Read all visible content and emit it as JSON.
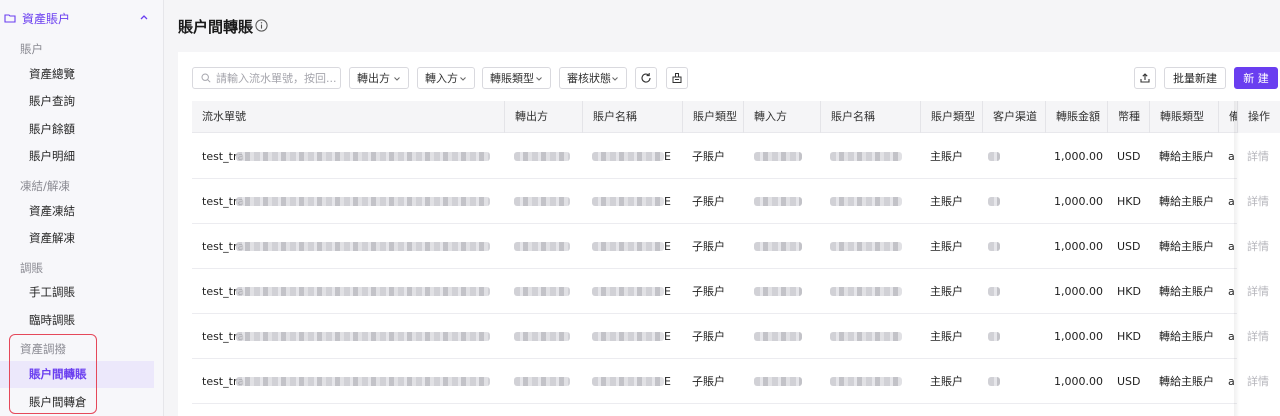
{
  "sidebar": {
    "top_label": "資產賬户",
    "groups": [
      {
        "label": "賬户",
        "items": [
          "資產總覽",
          "賬户查詢",
          "賬户餘額",
          "賬户明細"
        ]
      },
      {
        "label": "凍結/解凍",
        "items": [
          "資產凍結",
          "資產解凍"
        ]
      },
      {
        "label": "調賬",
        "items": [
          "手工調賬",
          "臨時調賬"
        ]
      },
      {
        "label": "資產調撥",
        "items": [
          "賬户間轉賬",
          "賬户間轉倉"
        ]
      }
    ],
    "active_item": "賬户間轉賬"
  },
  "page": {
    "title": "賬户間轉賬"
  },
  "filters": {
    "search_placeholder": "請輸入流水單號，按回...",
    "dropdowns": [
      "轉出方",
      "轉入方",
      "轉賬類型",
      "審核狀態"
    ]
  },
  "actions": {
    "batch_label": "批量新建",
    "new_label": "新 建"
  },
  "table": {
    "columns": [
      "流水單號",
      "轉出方",
      "賬户名稱",
      "賬户類型",
      "轉入方",
      "賬户名稱",
      "賬户類型",
      "客户渠道",
      "轉賬金額",
      "幣種",
      "轉賬類型",
      "備",
      "操作"
    ],
    "rows": [
      {
        "serial_prefix": "test_tra",
        "name_suffix": "E",
        "out_type": "子賬户",
        "in_type": "主賬户",
        "amount": "1,000.00",
        "currency": "USD",
        "transfer_type": "轉給主賬户",
        "remark": "a",
        "action": "詳情"
      },
      {
        "serial_prefix": "test_tra",
        "name_suffix": "E",
        "out_type": "子賬户",
        "in_type": "主賬户",
        "amount": "1,000.00",
        "currency": "HKD",
        "transfer_type": "轉給主賬户",
        "remark": "a",
        "action": "詳情"
      },
      {
        "serial_prefix": "test_tra",
        "name_suffix": "E",
        "out_type": "子賬户",
        "in_type": "主賬户",
        "amount": "1,000.00",
        "currency": "USD",
        "transfer_type": "轉給主賬户",
        "remark": "a",
        "action": "詳情"
      },
      {
        "serial_prefix": "test_tra",
        "name_suffix": "E",
        "out_type": "子賬户",
        "in_type": "主賬户",
        "amount": "1,000.00",
        "currency": "HKD",
        "transfer_type": "轉給主賬户",
        "remark": "a",
        "action": "詳情"
      },
      {
        "serial_prefix": "test_tra",
        "name_suffix": "E",
        "out_type": "子賬户",
        "in_type": "主賬户",
        "amount": "1,000.00",
        "currency": "HKD",
        "transfer_type": "轉給主賬户",
        "remark": "a",
        "action": "詳情"
      },
      {
        "serial_prefix": "test_tra",
        "name_suffix": "E",
        "out_type": "子賬户",
        "in_type": "主賬户",
        "amount": "1,000.00",
        "currency": "USD",
        "transfer_type": "轉給主賬户",
        "remark": "a",
        "action": "詳情"
      }
    ]
  },
  "colors": {
    "accent": "#6a3ef0",
    "highlight_border": "#e5485a"
  }
}
